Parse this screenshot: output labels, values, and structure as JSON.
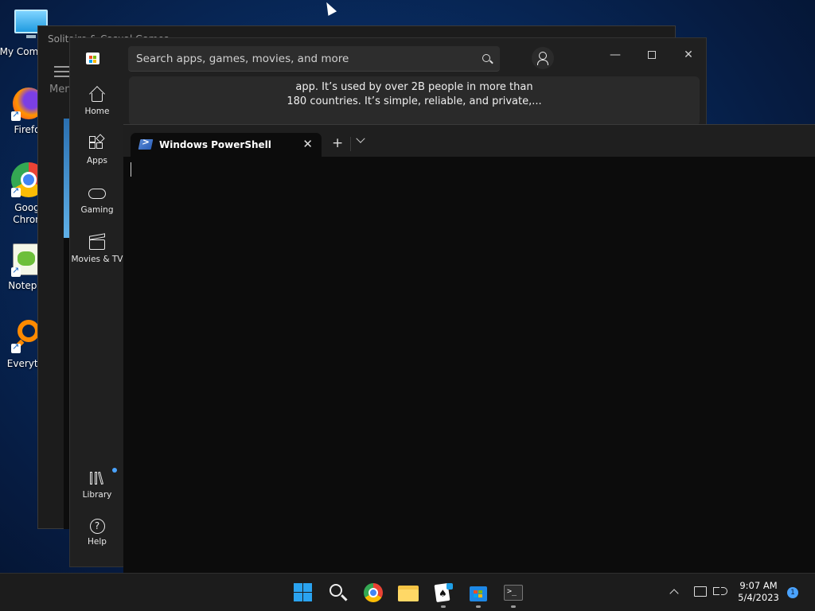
{
  "desktop": {
    "icons": [
      {
        "label": "My Com",
        "icon": "computer-icon"
      },
      {
        "label": "Firefo",
        "icon": "firefox-icon"
      },
      {
        "label": "Goog",
        "label2": "Chron",
        "icon": "chrome-icon"
      },
      {
        "label": "Notepa",
        "icon": "notepad-icon"
      },
      {
        "label": "Everyth",
        "icon": "everything-search-icon"
      }
    ]
  },
  "solitaire_window": {
    "title": "Solitaire & Casual Games",
    "menu_label": "Men"
  },
  "store_window": {
    "search_placeholder": "Search apps, games, movies, and more",
    "nav": {
      "home": "Home",
      "apps": "Apps",
      "gaming": "Gaming",
      "movies": "Movies & TV",
      "library": "Library",
      "help": "Help"
    },
    "library_badge_color": "#4aa3ff",
    "card_line1": "app. It’s used by over 2B people in more than",
    "card_line2": "180 countries. It’s simple, reliable, and private,..."
  },
  "terminal": {
    "tab_title": "Windows PowerShell",
    "close_glyph": "✕",
    "new_tab_glyph": "+"
  },
  "taskbar": {
    "items": [
      "start-icon",
      "search-icon",
      "chrome-icon",
      "file-explorer-icon",
      "solitaire-icon",
      "store-icon",
      "terminal-icon"
    ],
    "time": "9:07 AM",
    "date": "5/4/2023",
    "notification_count": "1",
    "accent": "#0078d4"
  }
}
